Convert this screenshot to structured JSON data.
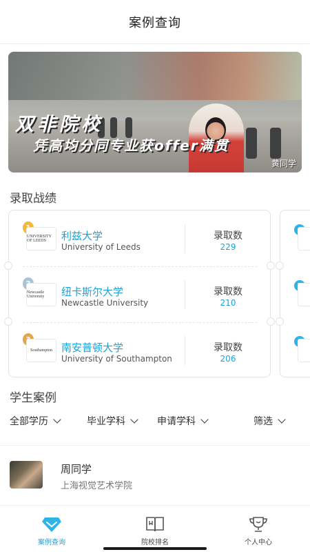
{
  "header": {
    "title": "案例查询"
  },
  "banner": {
    "line1": "双非院校",
    "line2": "凭高均分同专业获offer满贯",
    "caption": "黄同学"
  },
  "results": {
    "section_title": "录取战绩",
    "admit_label": "录取数",
    "universities": [
      {
        "rank": "1",
        "name_cn": "利兹大学",
        "name_en": "University of Leeds",
        "admits": "229",
        "logo_text": "UNIVERSITY OF LEEDS",
        "badge_color": "#f0b93a"
      },
      {
        "rank": "2",
        "name_cn": "纽卡斯尔大学",
        "name_en": "Newcastle University",
        "admits": "210",
        "logo_text": "Newcastle University",
        "badge_color": "#a8c3d6"
      },
      {
        "rank": "3",
        "name_cn": "南安普顿大学",
        "name_en": "University of Southampton",
        "admits": "206",
        "logo_text": "Southampton",
        "badge_color": "#e8a64a"
      }
    ],
    "peek_ranks": [
      "4",
      "5",
      "6"
    ]
  },
  "students": {
    "section_title": "学生案例",
    "filters": [
      "全部学历",
      "毕业学科",
      "申请学科",
      "筛选"
    ],
    "items": [
      {
        "name": "周同学",
        "school": "上海视觉艺术学院"
      }
    ]
  },
  "nav": {
    "items": [
      {
        "label": "案例查询",
        "icon": "diamond-icon",
        "active": true
      },
      {
        "label": "院校排名",
        "icon": "book-icon",
        "active": false
      },
      {
        "label": "个人中心",
        "icon": "trophy-icon",
        "active": false
      }
    ],
    "accent": "#1aa3d8"
  }
}
